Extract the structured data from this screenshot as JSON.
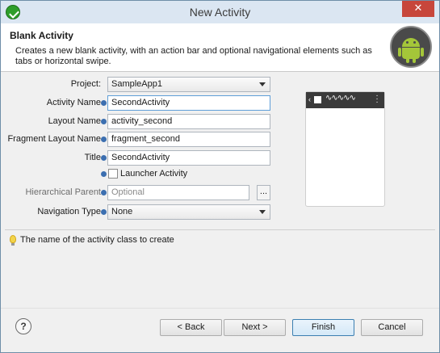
{
  "window": {
    "title": "New Activity"
  },
  "header": {
    "title": "Blank Activity",
    "description": "Creates a new blank activity, with an action bar and optional navigational elements such as tabs or horizontal swipe."
  },
  "form": {
    "project": {
      "label": "Project:",
      "value": "SampleApp1"
    },
    "activity_name": {
      "label": "Activity Name",
      "value": "SecondActivity"
    },
    "layout_name": {
      "label": "Layout Name",
      "value": "activity_second"
    },
    "fragment_layout_name": {
      "label": "Fragment Layout Name",
      "value": "fragment_second"
    },
    "title": {
      "label": "Title",
      "value": "SecondActivity"
    },
    "launcher_activity": {
      "label": "Launcher Activity",
      "checked": false
    },
    "hierarchical_parent": {
      "label": "Hierarchical Parent",
      "placeholder": "Optional",
      "browse_label": "..."
    },
    "navigation_type": {
      "label": "Navigation Type",
      "value": "None"
    }
  },
  "preview": {
    "actionbar_wave": "∿∿∿∿∿"
  },
  "hint": {
    "text": "The name of the activity class to create"
  },
  "buttons": {
    "help": "?",
    "back": "< Back",
    "next": "Next >",
    "finish": "Finish",
    "cancel": "Cancel"
  },
  "colors": {
    "accent": "#5f9ed8",
    "android_green": "#a4c639"
  }
}
